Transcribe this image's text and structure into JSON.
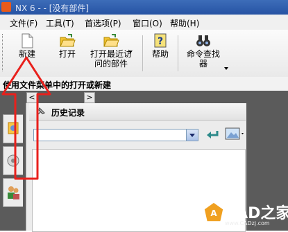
{
  "window": {
    "title": "NX 6 - - [没有部件]"
  },
  "menu": [
    "文件(F)",
    "工具(T)",
    "首选项(P)",
    "窗口(O)",
    "帮助(H)"
  ],
  "toolbar": {
    "new_label": "新建",
    "open_label": "打开",
    "recent_label_1": "打开最近访",
    "recent_label_2": "问的部件",
    "help_label": "帮助",
    "finder_label_1": "命令查找",
    "finder_label_2": "器"
  },
  "hint": "使用文件菜单中的打开或新建",
  "nav": {
    "back": "<",
    "forward": ">"
  },
  "panel": {
    "title": "历史记录",
    "search_value": ""
  },
  "watermark": {
    "text": "CAD之家",
    "url": "www.CADzj.com"
  },
  "colors": {
    "title_bar": "#2653a3",
    "annotation": "#e8201c",
    "dark_bg": "#5b5b5b"
  },
  "icons": [
    "new-file-icon",
    "open-folder-icon",
    "recent-folder-icon",
    "help-icon",
    "binoculars-icon",
    "pin-icon",
    "back-arrow-icon",
    "image-view-icon"
  ]
}
